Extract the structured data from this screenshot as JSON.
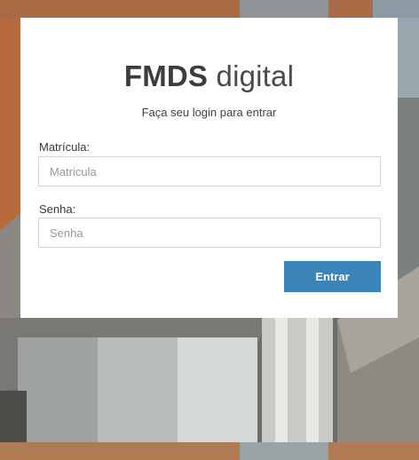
{
  "brand": {
    "bold": "FMDS",
    "light": "digital"
  },
  "login": {
    "subtitle": "Faça seu login para entrar",
    "matricula_label": "Matrícula:",
    "matricula_placeholder": "Matricula",
    "matricula_value": "",
    "senha_label": "Senha:",
    "senha_placeholder": "Senha",
    "senha_value": "",
    "submit_label": "Entrar"
  },
  "colors": {
    "button": "#3b84b8",
    "card": "#ffffff",
    "text": "#3c3c3c"
  }
}
